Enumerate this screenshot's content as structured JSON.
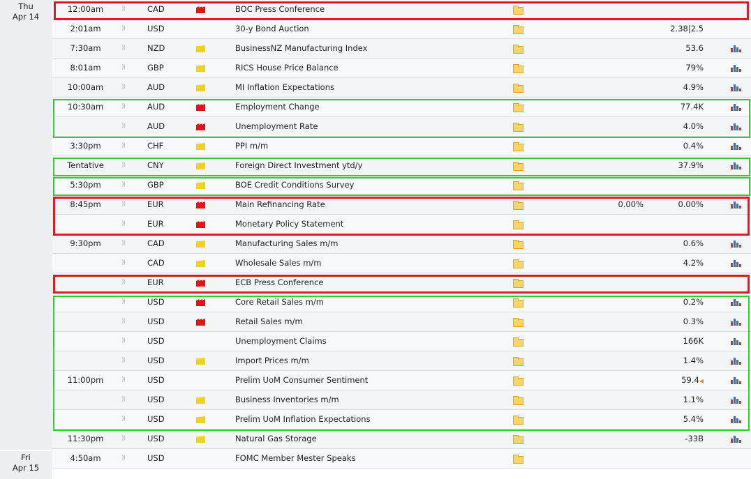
{
  "dates": [
    {
      "day": "Thu",
      "date": "Apr 14"
    },
    {
      "day": "Fri",
      "date": "Apr 15"
    }
  ],
  "colors": {
    "highlight_red": "#e01b24",
    "highlight_green": "#33cc33",
    "impact_high": "#e41414",
    "impact_medium": "#ef8a1c",
    "impact_low": "#f3d21c"
  },
  "icons": {
    "sound": "speaker-icon",
    "impact": "flag-icon",
    "report": "folder-icon",
    "chart": "bar-chart-icon"
  },
  "events": [
    {
      "time": "12:00am",
      "currency": "CAD",
      "impact": "high",
      "event": "BOC Press Conference",
      "previous": "",
      "actual": "",
      "chart": false
    },
    {
      "time": "2:01am",
      "currency": "USD",
      "impact": "medium",
      "event": "30-y Bond Auction",
      "previous": "",
      "actual": "2.38|2.5",
      "chart": false
    },
    {
      "time": "7:30am",
      "currency": "NZD",
      "impact": "low",
      "event": "BusinessNZ Manufacturing Index",
      "previous": "",
      "actual": "53.6",
      "chart": true
    },
    {
      "time": "8:01am",
      "currency": "GBP",
      "impact": "low",
      "event": "RICS House Price Balance",
      "previous": "",
      "actual": "79%",
      "chart": true
    },
    {
      "time": "10:00am",
      "currency": "AUD",
      "impact": "low",
      "event": "MI Inflation Expectations",
      "previous": "",
      "actual": "4.9%",
      "chart": true
    },
    {
      "time": "10:30am",
      "currency": "AUD",
      "impact": "high",
      "event": "Employment Change",
      "previous": "",
      "actual": "77.4K",
      "chart": true
    },
    {
      "time": "",
      "currency": "AUD",
      "impact": "high",
      "event": "Unemployment Rate",
      "previous": "",
      "actual": "4.0%",
      "chart": true
    },
    {
      "time": "3:30pm",
      "currency": "CHF",
      "impact": "low",
      "event": "PPI m/m",
      "previous": "",
      "actual": "0.4%",
      "chart": true
    },
    {
      "time": "Tentative",
      "currency": "CNY",
      "impact": "low",
      "event": "Foreign Direct Investment ytd/y",
      "previous": "",
      "actual": "37.9%",
      "chart": true
    },
    {
      "time": "5:30pm",
      "currency": "GBP",
      "impact": "low",
      "event": "BOE Credit Conditions Survey",
      "previous": "",
      "actual": "",
      "chart": false
    },
    {
      "time": "8:45pm",
      "currency": "EUR",
      "impact": "high",
      "event": "Main Refinancing Rate",
      "previous": "0.00%",
      "actual": "0.00%",
      "chart": true
    },
    {
      "time": "",
      "currency": "EUR",
      "impact": "high",
      "event": "Monetary Policy Statement",
      "previous": "",
      "actual": "",
      "chart": false
    },
    {
      "time": "9:30pm",
      "currency": "CAD",
      "impact": "low",
      "event": "Manufacturing Sales m/m",
      "previous": "",
      "actual": "0.6%",
      "chart": true
    },
    {
      "time": "",
      "currency": "CAD",
      "impact": "low",
      "event": "Wholesale Sales m/m",
      "previous": "",
      "actual": "4.2%",
      "chart": true
    },
    {
      "time": "",
      "currency": "EUR",
      "impact": "high",
      "event": "ECB Press Conference",
      "previous": "",
      "actual": "",
      "chart": false
    },
    {
      "time": "",
      "currency": "USD",
      "impact": "high",
      "event": "Core Retail Sales m/m",
      "previous": "",
      "actual": "0.2%",
      "chart": true
    },
    {
      "time": "",
      "currency": "USD",
      "impact": "high",
      "event": "Retail Sales m/m",
      "previous": "",
      "actual": "0.3%",
      "chart": true
    },
    {
      "time": "",
      "currency": "USD",
      "impact": "medium",
      "event": "Unemployment Claims",
      "previous": "",
      "actual": "166K",
      "chart": true
    },
    {
      "time": "",
      "currency": "USD",
      "impact": "low",
      "event": "Import Prices m/m",
      "previous": "",
      "actual": "1.4%",
      "chart": true
    },
    {
      "time": "11:00pm",
      "currency": "USD",
      "impact": "medium",
      "event": "Prelim UoM Consumer Sentiment",
      "previous": "",
      "actual": "59.4",
      "revised": true,
      "chart": true
    },
    {
      "time": "",
      "currency": "USD",
      "impact": "low",
      "event": "Business Inventories m/m",
      "previous": "",
      "actual": "1.1%",
      "chart": true
    },
    {
      "time": "",
      "currency": "USD",
      "impact": "low",
      "event": "Prelim UoM Inflation Expectations",
      "previous": "",
      "actual": "5.4%",
      "chart": true
    },
    {
      "time": "11:30pm",
      "currency": "USD",
      "impact": "low",
      "event": "Natural Gas Storage",
      "previous": "",
      "actual": "-33B",
      "chart": true
    },
    {
      "time": "4:50am",
      "currency": "USD",
      "impact": "medium",
      "event": "FOMC Member Mester Speaks",
      "previous": "",
      "actual": "",
      "chart": false
    }
  ]
}
